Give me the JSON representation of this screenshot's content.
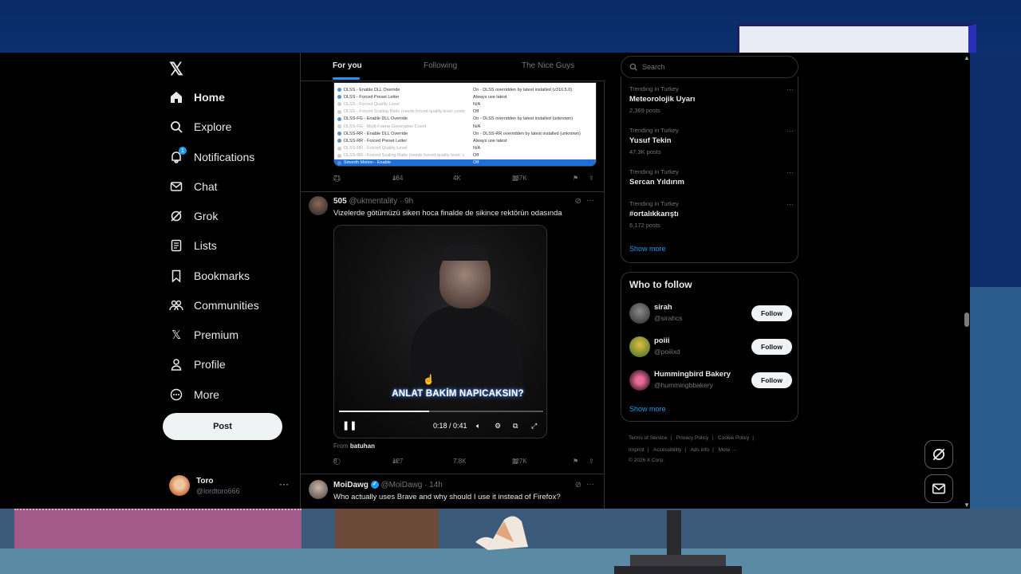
{
  "nav": {
    "items": [
      {
        "label": "Home",
        "icon": "home-icon"
      },
      {
        "label": "Explore",
        "icon": "search-icon"
      },
      {
        "label": "Notifications",
        "icon": "bell-icon",
        "badge": "1"
      },
      {
        "label": "Chat",
        "icon": "mail-icon"
      },
      {
        "label": "Grok",
        "icon": "grok-icon"
      },
      {
        "label": "Lists",
        "icon": "list-icon"
      },
      {
        "label": "Bookmarks",
        "icon": "bookmark-icon"
      },
      {
        "label": "Communities",
        "icon": "communities-icon"
      },
      {
        "label": "Premium",
        "icon": "x-icon"
      },
      {
        "label": "Profile",
        "icon": "person-icon"
      },
      {
        "label": "More",
        "icon": "more-icon"
      }
    ],
    "post_label": "Post"
  },
  "account": {
    "name": "Toro",
    "handle": "@lordtoro666"
  },
  "tabs": [
    "For you",
    "Following",
    "The Nice Guys"
  ],
  "tweet1": {
    "settings_rows": [
      {
        "k": "DLSS - Enable DLL Override",
        "v": "On - DLSS overridden by latest installed (v310.5.0)",
        "dim": false,
        "sel": false
      },
      {
        "k": "DLSS - Forced Preset Letter",
        "v": "Always use latest",
        "dim": false,
        "sel": false
      },
      {
        "k": "DLSS - Forced Quality Level",
        "v": "N/A",
        "dim": true,
        "sel": false
      },
      {
        "k": "DLSS - Forced Scaling Ratio (needs forced quality level: custo",
        "v": "Off",
        "dim": true,
        "sel": false
      },
      {
        "k": "DLSS-FG - Enable DLL Override",
        "v": "On - DLSS overridden by latest installed (unknown)",
        "dim": false,
        "sel": false
      },
      {
        "k": "DLSS-FG - Multi-Frame-Generation Count",
        "v": "N/A",
        "dim": true,
        "sel": false
      },
      {
        "k": "DLSS-RR - Enable DLL Override",
        "v": "On - DLSS-RR overridden by latest installed (unknown)",
        "dim": false,
        "sel": false
      },
      {
        "k": "DLSS-RR - Forced Preset Letter",
        "v": "Always use latest",
        "dim": false,
        "sel": false
      },
      {
        "k": "DLSS-RR - Forced Quality Level",
        "v": "N/A",
        "dim": true,
        "sel": false
      },
      {
        "k": "DLSS-RR - Forced Scaling Ratio (needs forced quality level: c",
        "v": "Off",
        "dim": true,
        "sel": false
      },
      {
        "k": "Smooth Motion - Enable",
        "v": "Off",
        "dim": false,
        "sel": true
      }
    ],
    "replies": "21",
    "reposts": "134",
    "likes": "4K",
    "views": "337K"
  },
  "tweet2": {
    "name": "505",
    "handle": "@ukmentality · 9h",
    "text": "Vizelerde götümüzü siken hoca finalde de sikince rektörün odasında",
    "caption": "ANLAT BAKİM NAPICAKSIN?",
    "time": "0:18 / 0:41",
    "progress": 0.44,
    "from_label": "From",
    "from_user": "batuhan",
    "replies": "8",
    "reposts": "127",
    "likes": "7.8K",
    "views": "327K"
  },
  "tweet3": {
    "name": "MoiDawg",
    "handle": "@MoiDawg · 14h",
    "text": "Who actually uses Brave and why should I use it instead of Firefox?"
  },
  "search": {
    "placeholder": "Search"
  },
  "trends": [
    {
      "cat": "Trending in Turkey",
      "title": "Meteorolojik Uyarı",
      "count": "2,369 posts"
    },
    {
      "cat": "Trending in Turkey",
      "title": "Yusuf Tekin",
      "count": "47.3K posts"
    },
    {
      "cat": "Trending in Turkey",
      "title": "Sercan Yıldırım",
      "count": ""
    },
    {
      "cat": "Trending in Turkey",
      "title": "#ortalıkkarıştı",
      "count": "6,172 posts"
    }
  ],
  "trends_show_more": "Show more",
  "who_to_follow": {
    "title": "Who to follow",
    "users": [
      {
        "name": "sirah",
        "handle": "@sirahcs",
        "btn": "Follow"
      },
      {
        "name": "poiii",
        "handle": "@poiiixd",
        "btn": "Follow"
      },
      {
        "name": "Hummingbird Bakery",
        "handle": "@hummingbbakery",
        "btn": "Follow"
      }
    ],
    "show_more": "Show more"
  },
  "footer": {
    "line1": [
      "Terms of Service",
      "|",
      "Privacy Policy",
      "|",
      "Cookie Policy",
      "|"
    ],
    "line2": [
      "Imprint",
      "|",
      "Accessibility",
      "|",
      "Ads info",
      "|",
      "More ···"
    ],
    "copyright": "© 2026 X Corp."
  },
  "colors": {
    "accent": "#1d9bf0",
    "background": "#000000",
    "text": "#e7e9ea",
    "muted": "#71767b"
  }
}
